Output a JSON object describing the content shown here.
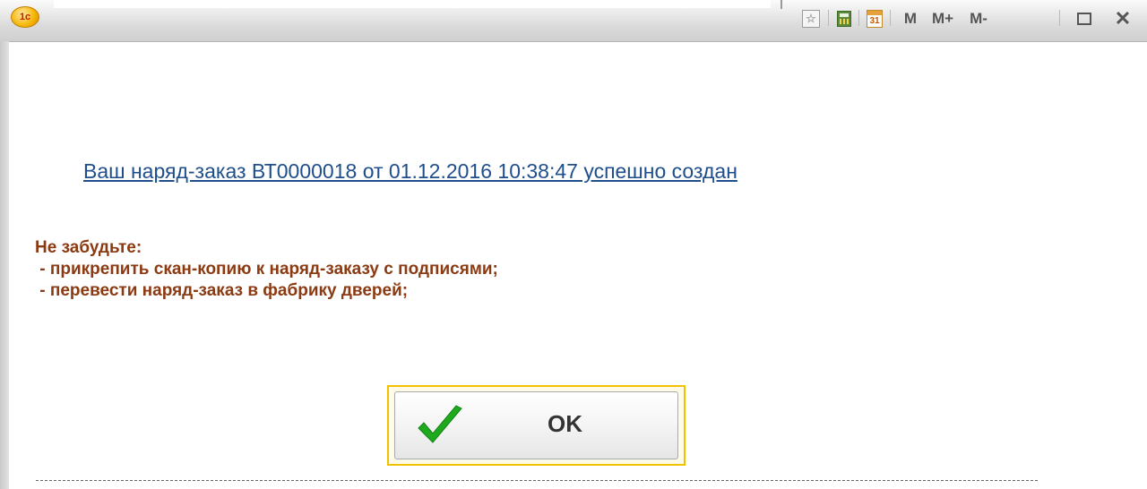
{
  "titlebar": {
    "logo_text": "1c",
    "buttons": [
      {
        "name": "favorites-icon"
      },
      {
        "name": "calculator-icon"
      },
      {
        "name": "calendar-icon",
        "text": "31"
      },
      {
        "name": "memory-button",
        "text": "M"
      },
      {
        "name": "memory-plus-button",
        "text": "M+"
      },
      {
        "name": "memory-minus-button",
        "text": "M-"
      },
      {
        "name": "maximize-icon"
      },
      {
        "name": "close-icon",
        "text": "✕"
      }
    ]
  },
  "message": {
    "link_text": "Ваш наряд-заказ ВТ0000018 от 01.12.2016 10:38:47 успешно создан",
    "reminder_lines": [
      "Не забудьте:",
      " - прикрепить скан-копию к наряд-заказу с подписями;",
      " - перевести наряд-заказ в фабрику дверей;"
    ]
  },
  "ok_button": {
    "label": "OK"
  },
  "colors": {
    "link": "#1f4e8c",
    "reminder": "#8b3a12",
    "check": "#1fa91f",
    "ok_frame": "#f0c200"
  }
}
